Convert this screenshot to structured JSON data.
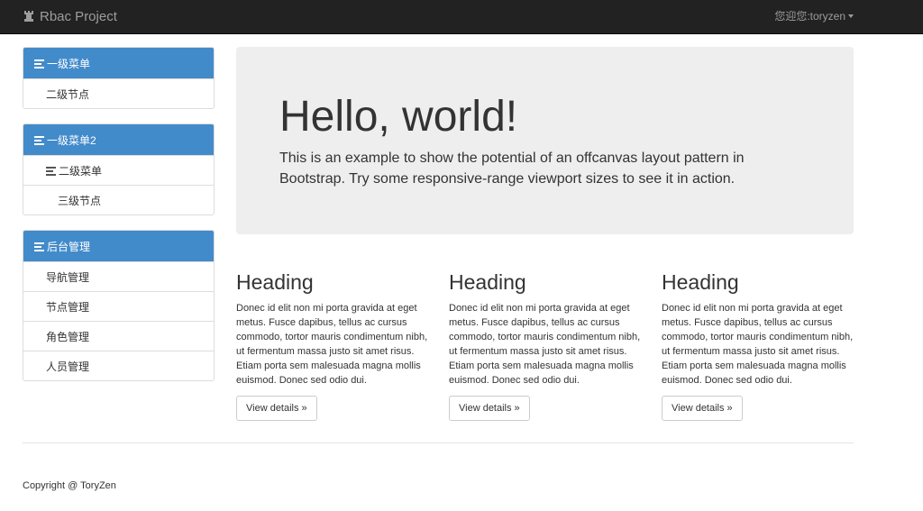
{
  "navbar": {
    "brand": "Rbac Project",
    "brand_icon": "rook-icon",
    "user_label": "您迎您:toryzen"
  },
  "sidebar": {
    "panels": [
      {
        "title": "一级菜单",
        "icon": "list-icon",
        "items": [
          {
            "label": "二级节点",
            "level": 2
          }
        ]
      },
      {
        "title": "一级菜单2",
        "icon": "list-icon",
        "items": [
          {
            "label": "二级菜单",
            "level": 2,
            "icon": "list-icon"
          },
          {
            "label": "三级节点",
            "level": 3
          }
        ]
      },
      {
        "title": "后台管理",
        "icon": "list-icon",
        "items": [
          {
            "label": "导航管理",
            "level": 2
          },
          {
            "label": "节点管理",
            "level": 2
          },
          {
            "label": "角色管理",
            "level": 2
          },
          {
            "label": "人员管理",
            "level": 2
          }
        ]
      }
    ]
  },
  "jumbotron": {
    "title": "Hello, world!",
    "text": "This is an example to show the potential of an offcanvas layout pattern in Bootstrap. Try some responsive-range viewport sizes to see it in action."
  },
  "columns": [
    {
      "heading": "Heading",
      "text": "Donec id elit non mi porta gravida at eget metus. Fusce dapibus, tellus ac cursus commodo, tortor mauris condimentum nibh, ut fermentum massa justo sit amet risus. Etiam porta sem malesuada magna mollis euismod. Donec sed odio dui.",
      "button": "View details »"
    },
    {
      "heading": "Heading",
      "text": "Donec id elit non mi porta gravida at eget metus. Fusce dapibus, tellus ac cursus commodo, tortor mauris condimentum nibh, ut fermentum massa justo sit amet risus. Etiam porta sem malesuada magna mollis euismod. Donec sed odio dui.",
      "button": "View details »"
    },
    {
      "heading": "Heading",
      "text": "Donec id elit non mi porta gravida at eget metus. Fusce dapibus, tellus ac cursus commodo, tortor mauris condimentum nibh, ut fermentum massa justo sit amet risus. Etiam porta sem malesuada magna mollis euismod. Donec sed odio dui.",
      "button": "View details »"
    }
  ],
  "footer": {
    "copyright": "Copyright @ ToryZen"
  },
  "colors": {
    "navbar_bg": "#222222",
    "panel_heading_bg": "#428bca",
    "jumbotron_bg": "#eeeeee"
  }
}
